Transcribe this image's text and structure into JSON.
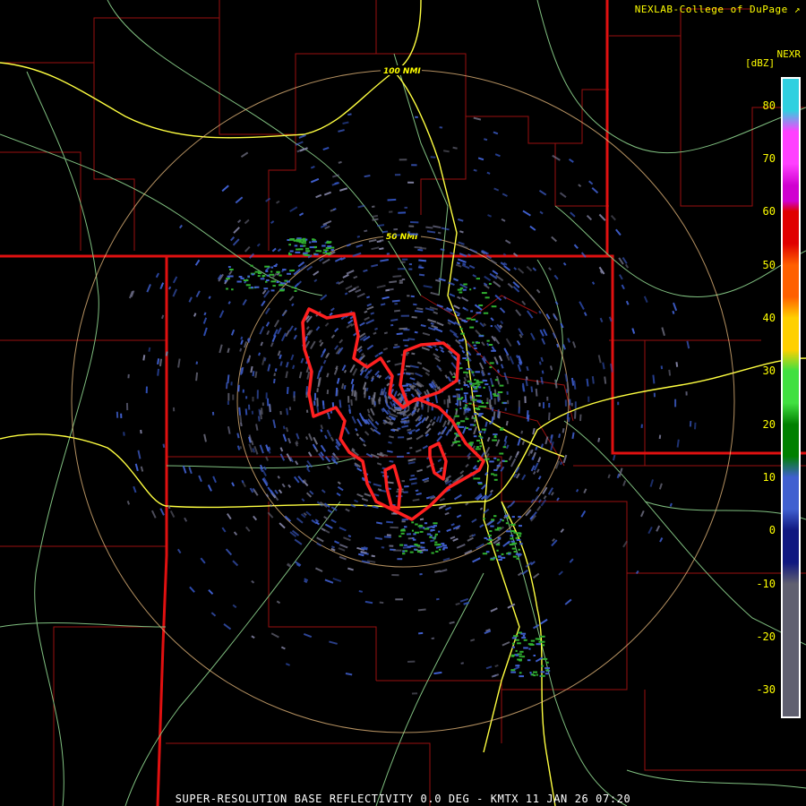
{
  "credit": "NEXLAB-College of DuPage",
  "credit_icon": "external-link-icon",
  "product_code": "NEXR",
  "units": "[dBZ]",
  "caption": "SUPER-RESOLUTION BASE REFLECTIVITY 0.0 DEG - KMTX 11 JAN 26 07:20",
  "range_rings": [
    {
      "label": "100 NMI",
      "nmi": 100
    },
    {
      "label": "50 NMI",
      "nmi": 50
    }
  ],
  "colorbar": {
    "ticks": [
      "80",
      "70",
      "60",
      "50",
      "40",
      "30",
      "20",
      "10",
      "0",
      "-10",
      "-20",
      "-30"
    ],
    "min": -35,
    "max": 85,
    "segments": [
      {
        "from": 75,
        "to": 85,
        "color": "#30d0e0"
      },
      {
        "from": 65,
        "to": 75,
        "color": "#ff40ff"
      },
      {
        "from": 60,
        "to": 65,
        "color": "#d000d0"
      },
      {
        "from": 50,
        "to": 60,
        "color": "#e00000"
      },
      {
        "from": 40,
        "to": 50,
        "color": "#ff6000"
      },
      {
        "from": 30,
        "to": 40,
        "color": "#ffd000"
      },
      {
        "from": 20,
        "to": 30,
        "color": "#40e040"
      },
      {
        "from": 10,
        "to": 20,
        "color": "#008000"
      },
      {
        "from": 0,
        "to": 10,
        "color": "#4060d0"
      },
      {
        "from": -10,
        "to": 0,
        "color": "#101880"
      },
      {
        "from": -35,
        "to": -10,
        "color": "#606070"
      }
    ]
  },
  "colors": {
    "state_border": "#e01010",
    "county_line": "#9a1010",
    "highway": "#ffff40",
    "road": "#80c080",
    "warning_outline": "#ff2020",
    "ring": "#f0c080"
  }
}
